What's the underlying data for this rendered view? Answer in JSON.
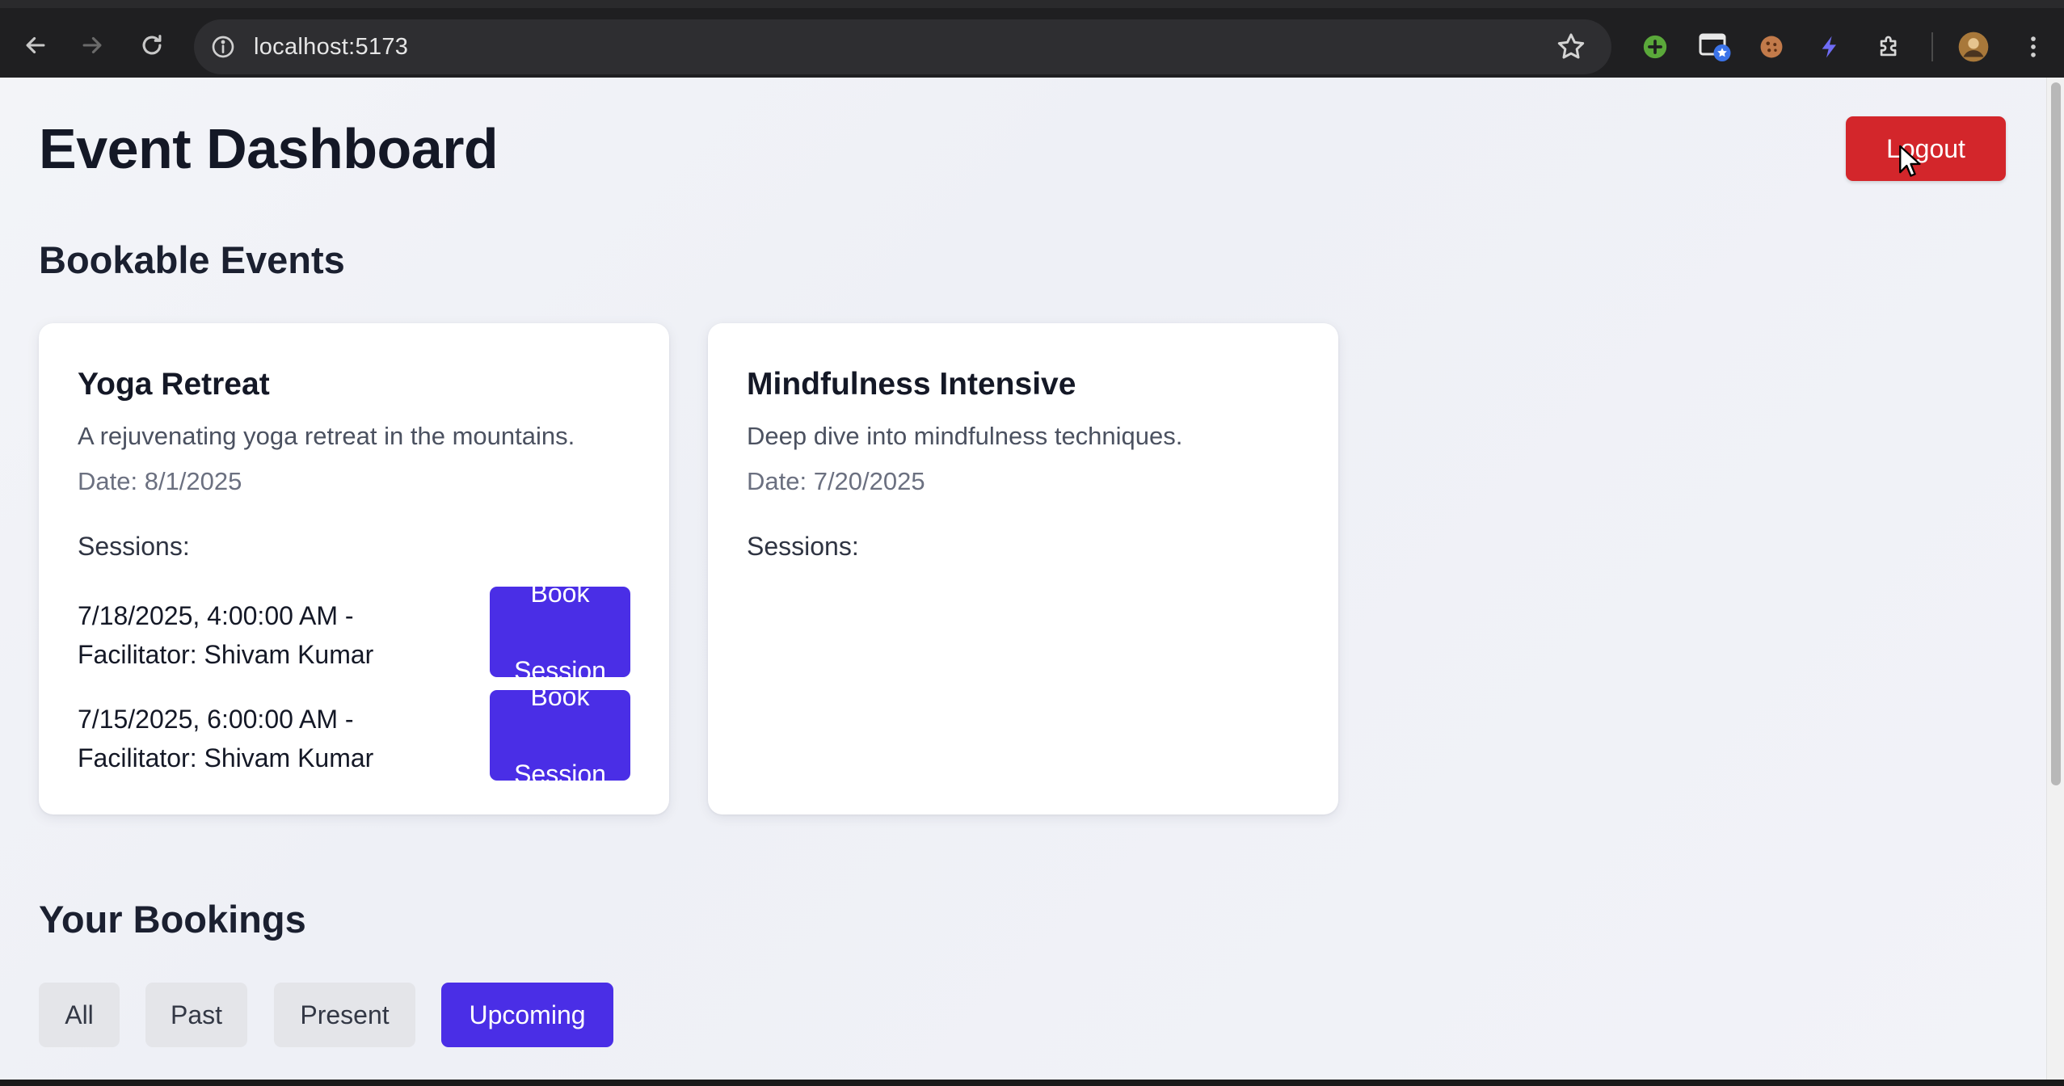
{
  "browser": {
    "url": "localhost:5173"
  },
  "page": {
    "title": "Event Dashboard",
    "logout_label": "Logout",
    "bookable_title": "Bookable Events",
    "bookings_title": "Your Bookings"
  },
  "events": [
    {
      "title": "Yoga Retreat",
      "description": "A rejuvenating yoga retreat in the mountains.",
      "date": "Date: 8/1/2025",
      "sessions_label": "Sessions:",
      "sessions": [
        {
          "line1": "7/18/2025, 4:00:00 AM -",
          "line2": "Facilitator: Shivam Kumar",
          "button": "Book Session"
        },
        {
          "line1": "7/15/2025, 6:00:00 AM -",
          "line2": "Facilitator: Shivam Kumar",
          "button": "Book Session"
        }
      ]
    },
    {
      "title": "Mindfulness Intensive",
      "description": "Deep dive into mindfulness techniques.",
      "date": "Date: 7/20/2025",
      "sessions_label": "Sessions:",
      "sessions": []
    }
  ],
  "filters": [
    {
      "label": "All",
      "active": false
    },
    {
      "label": "Past",
      "active": false
    },
    {
      "label": "Present",
      "active": false
    },
    {
      "label": "Upcoming",
      "active": true
    }
  ],
  "colors": {
    "primary": "#4a2ee6",
    "danger": "#d3262b"
  },
  "icons": {
    "back": "arrow-left",
    "forward": "arrow-right",
    "reload": "reload",
    "site_info": "info",
    "bookmark": "star",
    "extensions": [
      "green-plus",
      "tab-star",
      "cookie",
      "bolt",
      "puzzle"
    ],
    "profile": "avatar",
    "menu": "kebab"
  }
}
